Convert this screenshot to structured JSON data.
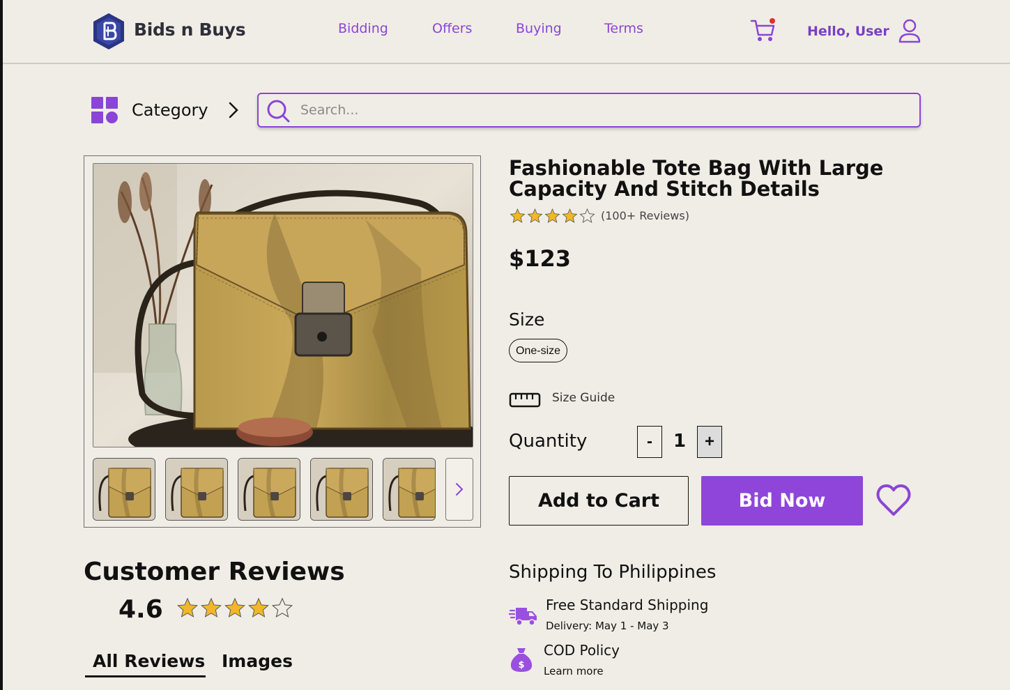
{
  "header": {
    "brand": "Bids n Buys",
    "nav": [
      "Bidding",
      "Offers",
      "Buying",
      "Terms"
    ],
    "greeting": "Hello, User",
    "icons": [
      "logo-shield-icon",
      "cart-icon",
      "user-icon"
    ],
    "cart_has_notification": true
  },
  "toolbar": {
    "category_label": "Category",
    "search_placeholder": "Search..."
  },
  "product": {
    "title": "Fashionable Tote Bag With Large Capacity And Stitch Details",
    "rating": 4,
    "review_count_text": "(100+ Reviews)",
    "price": "$123",
    "size_label": "Size",
    "size_option": "One-size",
    "size_guide": "Size Guide",
    "quantity_label": "Quantity",
    "quantity_minus": "-",
    "quantity_value": "1",
    "quantity_plus": "+",
    "add_to_cart": "Add to Cart",
    "bid_now": "Bid Now"
  },
  "reviews": {
    "title": "Customer Reviews",
    "average": "4.6",
    "stars": 4,
    "tabs": [
      "All Reviews",
      "Images"
    ]
  },
  "shipping": {
    "title": "Shipping To Philippines",
    "free_shipping": "Free Standard Shipping",
    "delivery": "Delivery: May 1 - May 3",
    "cod": "COD Policy",
    "learn_more": "Learn more"
  },
  "colors": {
    "background": "#f0ede6",
    "accent": "#8f45d9",
    "star": "#f2b628"
  }
}
